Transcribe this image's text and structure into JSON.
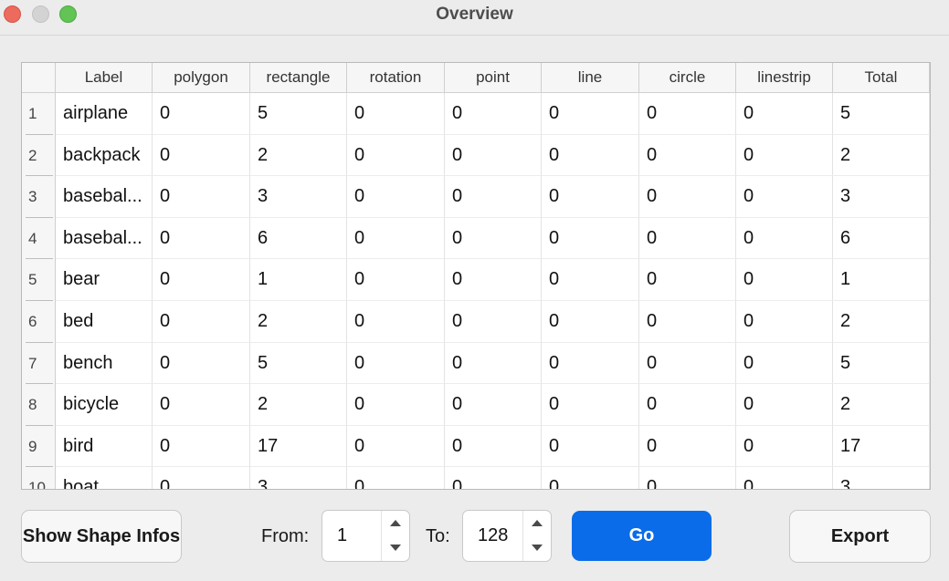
{
  "window": {
    "title": "Overview"
  },
  "table": {
    "columns": [
      "Label",
      "polygon",
      "rectangle",
      "rotation",
      "point",
      "line",
      "circle",
      "linestrip",
      "Total"
    ],
    "rows": [
      {
        "num": "1",
        "cells": [
          "airplane",
          "0",
          "5",
          "0",
          "0",
          "0",
          "0",
          "0",
          "5"
        ]
      },
      {
        "num": "2",
        "cells": [
          "backpack",
          "0",
          "2",
          "0",
          "0",
          "0",
          "0",
          "0",
          "2"
        ]
      },
      {
        "num": "3",
        "cells": [
          "basebal...",
          "0",
          "3",
          "0",
          "0",
          "0",
          "0",
          "0",
          "3"
        ]
      },
      {
        "num": "4",
        "cells": [
          "basebal...",
          "0",
          "6",
          "0",
          "0",
          "0",
          "0",
          "0",
          "6"
        ]
      },
      {
        "num": "5",
        "cells": [
          "bear",
          "0",
          "1",
          "0",
          "0",
          "0",
          "0",
          "0",
          "1"
        ]
      },
      {
        "num": "6",
        "cells": [
          "bed",
          "0",
          "2",
          "0",
          "0",
          "0",
          "0",
          "0",
          "2"
        ]
      },
      {
        "num": "7",
        "cells": [
          "bench",
          "0",
          "5",
          "0",
          "0",
          "0",
          "0",
          "0",
          "5"
        ]
      },
      {
        "num": "8",
        "cells": [
          "bicycle",
          "0",
          "2",
          "0",
          "0",
          "0",
          "0",
          "0",
          "2"
        ]
      },
      {
        "num": "9",
        "cells": [
          "bird",
          "0",
          "17",
          "0",
          "0",
          "0",
          "0",
          "0",
          "17"
        ]
      },
      {
        "num": "10",
        "cells": [
          "boat",
          "0",
          "3",
          "0",
          "0",
          "0",
          "0",
          "0",
          "3"
        ]
      }
    ]
  },
  "controls": {
    "show_shape_label": "Show Shape Infos",
    "from_label": "From:",
    "from_value": "1",
    "to_label": "To:",
    "to_value": "128",
    "go_label": "Go",
    "export_label": "Export"
  },
  "colors": {
    "accent": "#0a6ce8"
  }
}
